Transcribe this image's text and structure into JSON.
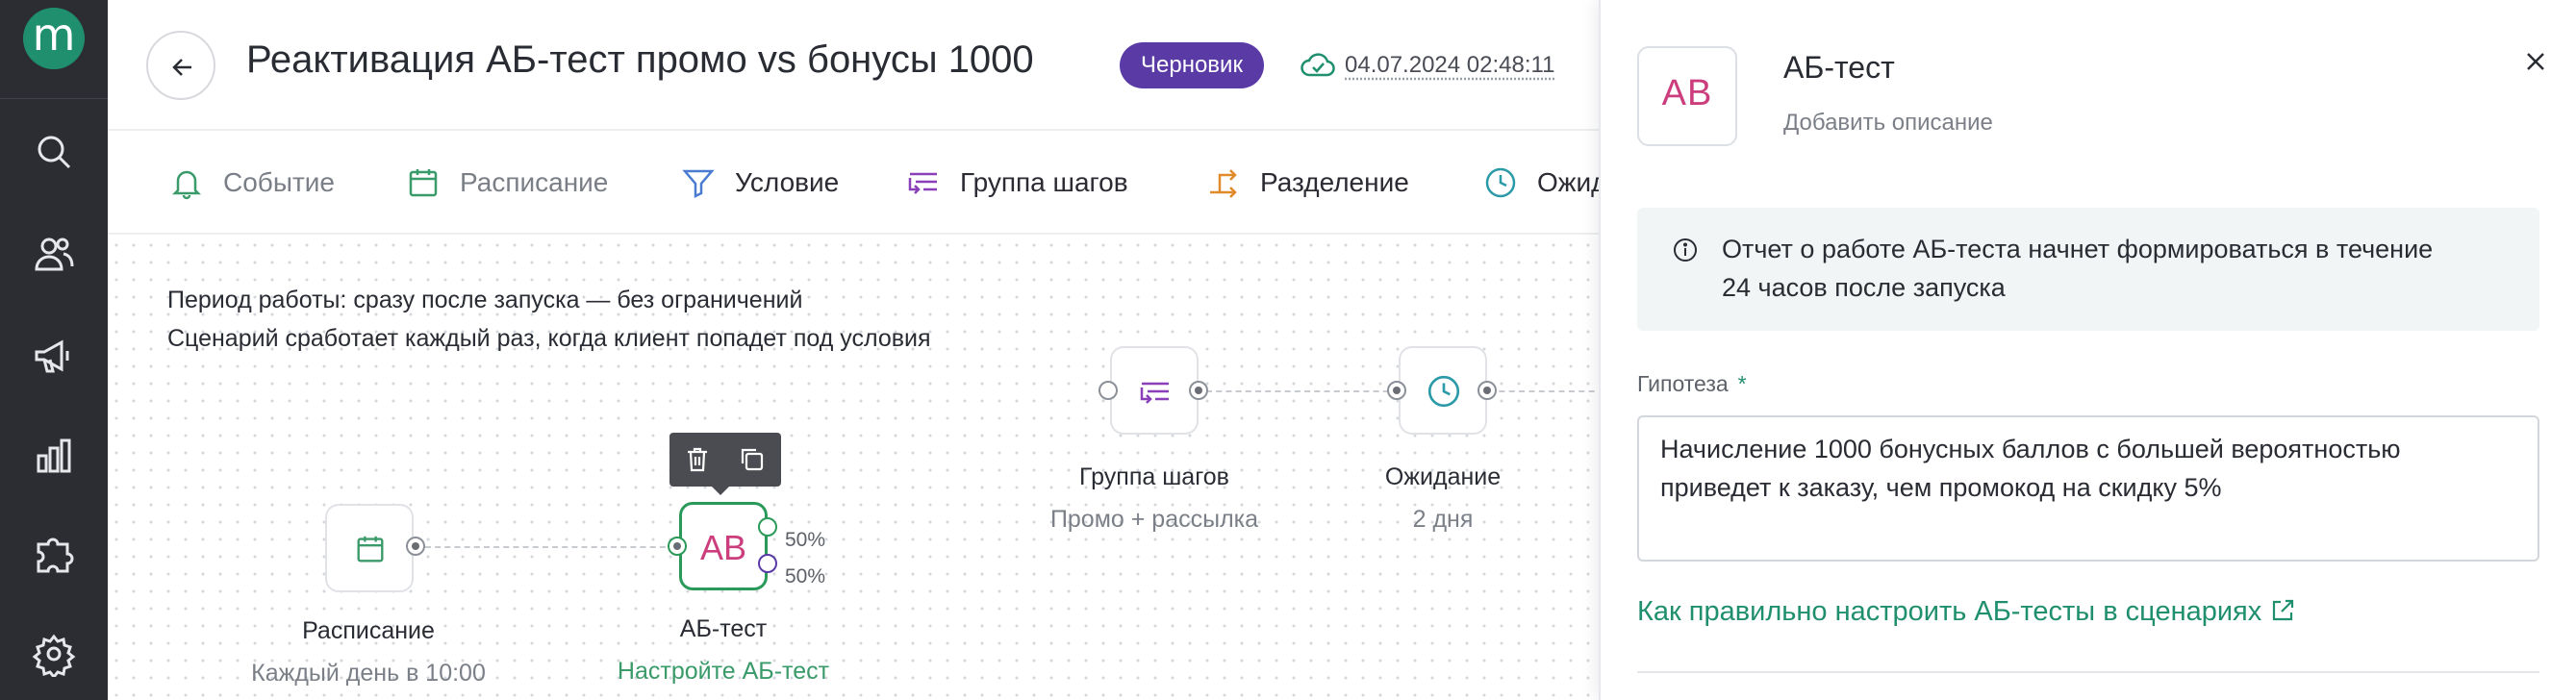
{
  "app": {
    "logo_letter": "m"
  },
  "rail": {
    "icons": [
      "search-icon",
      "users-icon",
      "megaphone-icon",
      "analytics-icon",
      "puzzle-icon",
      "settings-icon"
    ]
  },
  "header": {
    "title": "Реактивация АБ-тест промо vs бонусы 1000",
    "status_badge": "Черновик",
    "saved_at": "04.07.2024 02:48:11"
  },
  "toolbar": {
    "items": [
      {
        "label": "Событие",
        "icon": "bell-icon"
      },
      {
        "label": "Расписание",
        "icon": "calendar-icon"
      },
      {
        "label": "Условие",
        "icon": "filter-icon"
      },
      {
        "label": "Группа шагов",
        "icon": "step-group-icon"
      },
      {
        "label": "Разделение",
        "icon": "split-icon"
      },
      {
        "label": "Ожидание",
        "icon": "clock-icon"
      }
    ]
  },
  "canvas": {
    "info_line_1": "Период работы: сразу после запуска — без ограничений",
    "info_line_2": "Сценарий сработает каждый раз, когда клиент попадет под условия",
    "nodes": {
      "schedule": {
        "label": "Расписание",
        "sub": "Каждый день в 10:00"
      },
      "abtest": {
        "label": "АБ-тест",
        "sub": "Настройте АБ-тест",
        "icon_text": "AB",
        "branch_a": "50%",
        "branch_b": "50%"
      },
      "step_group": {
        "label": "Группа шагов",
        "sub": "Промо + рассылка"
      },
      "wait": {
        "label": "Ожидание",
        "sub": "2 дня"
      }
    }
  },
  "panel": {
    "icon_text": "AB",
    "title": "АБ-тест",
    "description_placeholder": "Добавить описание",
    "notice_line_1": "Отчет о работе АБ-теста начнет формироваться в течение",
    "notice_line_2": "24 часов после запуска",
    "hypothesis_label": "Гипотеза",
    "required_mark": "*",
    "hypothesis_line_1": "Начисление 1000 бонусных баллов с большей вероятностью",
    "hypothesis_line_2": "приведет к заказу, чем промокод на скидку 5%",
    "help_link": "Как правильно настроить АБ-тесты в сценариях"
  },
  "colors": {
    "accent": "#1f8f6e",
    "badge": "#5a3ba6",
    "rail": "#2b2d33",
    "ab_pink": "#cb3d7c"
  }
}
